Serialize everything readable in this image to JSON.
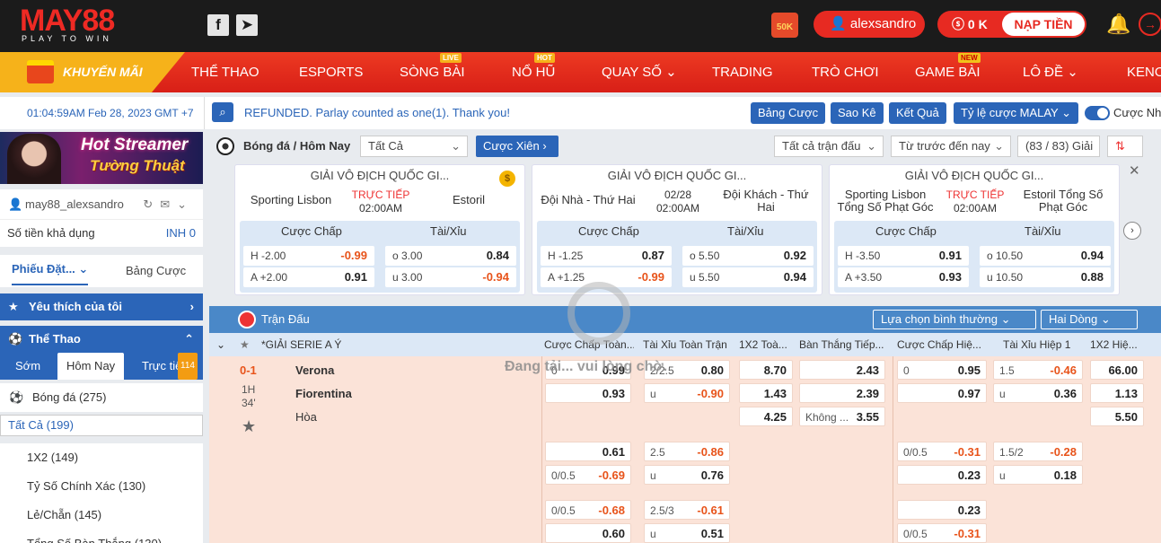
{
  "header": {
    "logo": "MAY88",
    "logo_sub": "PLAY TO WIN",
    "gift_label": "50K",
    "username": "alexsandro",
    "balance": "0 K",
    "deposit_label": "NẠP TIỀN"
  },
  "nav": {
    "promo": "KHUYẾN MÃI",
    "items": [
      {
        "label": "THỂ THAO",
        "tag": ""
      },
      {
        "label": "ESPORTS",
        "tag": ""
      },
      {
        "label": "SÒNG BÀI",
        "tag": "LIVE"
      },
      {
        "label": "NỔ HŨ",
        "tag": "HOT"
      },
      {
        "label": "QUAY SỐ",
        "tag": ""
      },
      {
        "label": "TRADING",
        "tag": ""
      },
      {
        "label": "TRÒ CHƠI",
        "tag": ""
      },
      {
        "label": "GAME BÀI",
        "tag": "NEW"
      },
      {
        "label": "LÔ ĐỀ",
        "tag": ""
      },
      {
        "label": "KENO",
        "tag": ""
      }
    ]
  },
  "subbar": {
    "datetime": "01:04:59AM Feb 28, 2023 GMT +7",
    "notice": "REFUNDED. Parlay counted as one(1). Thank you!",
    "btn_bet_list": "Bảng Cược",
    "btn_results_short": "Sao Kê",
    "btn_results": "Kết Quả",
    "odds_type": "Tỷ lệ cược MALAY",
    "toggle_label": "Cược Nhanh"
  },
  "left": {
    "banner_line1": "Hot Streamer",
    "banner_line2": "Tường Thuật",
    "account": "may88_alexsandro",
    "funds_label": "Số tiền khả dụng",
    "funds_value": "INH 0",
    "tab_slip": "Phiếu Đặt...",
    "tab_bets": "Bảng Cược",
    "fav": "Yêu thích của tôi",
    "sports": "Thể Thao",
    "subtab_early": "Sớm",
    "subtab_today": "Hôm Nay",
    "subtab_live": "Trực tiếp",
    "live_count": "114",
    "football": "Bóng đá (275)",
    "markets": [
      "Tất Cả (199)",
      "1X2 (149)",
      "Tỷ Số Chính Xác (130)",
      "Lẻ/Chẵn (145)",
      "Tổng Số Bàn Thắng (130)"
    ]
  },
  "main": {
    "title": "Bóng đá / Hôm Nay",
    "filter": "Tất Cả",
    "parlay": "Cược Xiên",
    "all_matches": "Tất cả trận đấu",
    "sort": "Từ trước đến nay",
    "count": "(83 / 83) Giải"
  },
  "cards": [
    {
      "league": "GIẢI VÔ ĐỊCH QUỐC GI...",
      "home": "Sporting Lisbon",
      "away": "Estoril",
      "status": "TRỰC TIẾP",
      "time": "02:00AM",
      "hdp_h": "H -2.00",
      "hdp_h_odd": "-0.99",
      "hdp_a": "A +2.00",
      "hdp_a_odd": "0.91",
      "ou_o": "o 3.00",
      "ou_o_odd": "0.84",
      "ou_u": "u 3.00",
      "ou_u_odd": "-0.94"
    },
    {
      "league": "GIẢI VÔ ĐỊCH QUỐC GI...",
      "home": "Đội Nhà - Thứ Hai",
      "away": "Đội Khách - Thứ Hai",
      "status": "02/28",
      "time": "02:00AM",
      "hdp_h": "H -1.25",
      "hdp_h_odd": "0.87",
      "hdp_a": "A +1.25",
      "hdp_a_odd": "-0.99",
      "ou_o": "o 5.50",
      "ou_o_odd": "0.92",
      "ou_u": "u 5.50",
      "ou_u_odd": "0.94"
    },
    {
      "league": "GIẢI VÔ ĐỊCH QUỐC GI...",
      "home": "Sporting Lisbon Tổng Số Phạt Góc",
      "away": "Estoril Tổng Số Phạt Góc",
      "status": "TRỰC TIẾP",
      "time": "02:00AM",
      "hdp_h": "H -3.50",
      "hdp_h_odd": "0.91",
      "hdp_a": "A +3.50",
      "hdp_a_odd": "0.93",
      "ou_o": "o 10.50",
      "ou_o_odd": "0.94",
      "ou_u": "u 10.50",
      "ou_u_odd": "0.88"
    }
  ],
  "card_labels": {
    "hdp": "Cược Chấp",
    "ou": "Tài/Xỉu"
  },
  "grid": {
    "title": "Trận Đấu",
    "select_mode": "Lựa chọn bình thường",
    "select_lines": "Hai Dòng",
    "league": "*GIẢI SERIE A Ý",
    "cols": [
      "Cược Chấp Toàn...",
      "Tài Xỉu Toàn Trận",
      "1X2 Toà...",
      "Bàn Thắng Tiếp...",
      "Cược Chấp Hiệ...",
      "Tài Xỉu Hiệp 1",
      "1X2 Hiệ..."
    ],
    "score": "0-1",
    "period": "1H",
    "minute": "34'",
    "home": "Verona",
    "away": "Fiorentina",
    "draw": "Hòa",
    "next_goal_none": "Không ...",
    "loading": "Đang tải... vui lòng chờ."
  }
}
